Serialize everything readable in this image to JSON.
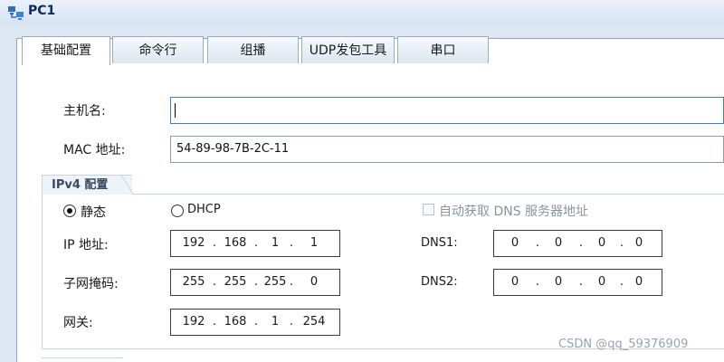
{
  "window": {
    "title": "PC1",
    "icon": "pc-network-icon"
  },
  "tabs": [
    {
      "label": "基础配置",
      "active": true
    },
    {
      "label": "命令行",
      "active": false
    },
    {
      "label": "组播",
      "active": false
    },
    {
      "label": "UDP发包工具",
      "active": false
    },
    {
      "label": "串口",
      "active": false
    }
  ],
  "host": {
    "label": "主机名:",
    "value": ""
  },
  "mac": {
    "label": "MAC 地址:",
    "value": "54-89-98-7B-2C-11"
  },
  "ipv4": {
    "group_title": "IPv4 配置",
    "static_label": "静态",
    "dhcp_label": "DHCP",
    "mode": "static",
    "auto_dns_label": "自动获取 DNS 服务器地址",
    "auto_dns_checked": false,
    "ip_label": "IP 地址:",
    "ip": [
      "192",
      "168",
      "1",
      "1"
    ],
    "mask_label": "子网掩码:",
    "mask": [
      "255",
      "255",
      "255",
      "0"
    ],
    "gateway_label": "网关:",
    "gateway": [
      "192",
      "168",
      "1",
      "254"
    ],
    "dns1_label": "DNS1:",
    "dns1": [
      "0",
      "0",
      "0",
      "0"
    ],
    "dns2_label": "DNS2:",
    "dns2": [
      "0",
      "0",
      "0",
      "0"
    ]
  },
  "watermark": "CSDN @qq_59376909"
}
